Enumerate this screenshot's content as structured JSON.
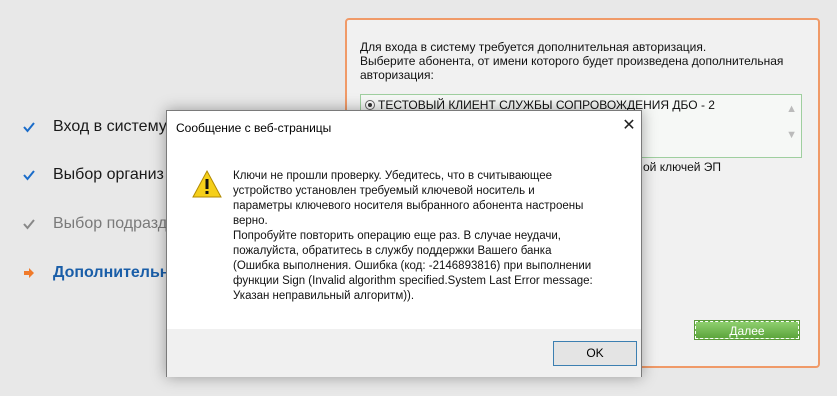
{
  "steps": [
    {
      "label": "Вход в системуВ",
      "state": "done"
    },
    {
      "label": "Выбор организ",
      "state": "done"
    },
    {
      "label": "Выбор подразд",
      "state": "disabled"
    },
    {
      "label": "Дополнительн",
      "state": "current"
    }
  ],
  "auth_panel": {
    "line1": "Для входа в систему требуется дополнительная авторизация.",
    "line2": "Выберите абонента, от имени которого будет произведена дополнительная",
    "line3": "авторизация:",
    "client": "ТЕСТОВЫЙ КЛИЕНТ СЛУЖБЫ СОПРОВОЖДЕНИЯ ДБО - 2",
    "keys_label": "ой ключей ЭП",
    "next_button": "Далее"
  },
  "dialog": {
    "title": "Сообщение с веб-страницы",
    "close": "✕",
    "lines": [
      "Ключи не прошли проверку. Убедитесь, что в считывающее",
      "устройство установлен требуемый ключевой носитель и",
      "параметры ключевого носителя выбранного абонента настроены",
      "верно.",
      "Попробуйте повторить операцию еще раз. В случае неудачи,",
      "пожалуйста, обратитесь в службу поддержки Вашего банка",
      "(Ошибка выполнения. Ошибка (код: -2146893816) при выполнении",
      "функции Sign (Invalid algorithm specified.System Last Error message:",
      "Указан неправильный алгоритм))."
    ],
    "ok_button": "OK"
  },
  "colors": {
    "done_check": "#1a6cc9",
    "disabled_check": "#888888",
    "current_arrow": "#f07a2a",
    "panel_border": "#f09a68",
    "next_button": "#6db34a"
  },
  "icons": {
    "step_done": "check-icon",
    "step_current": "arrow-right-icon",
    "dialog": "warning-icon"
  }
}
